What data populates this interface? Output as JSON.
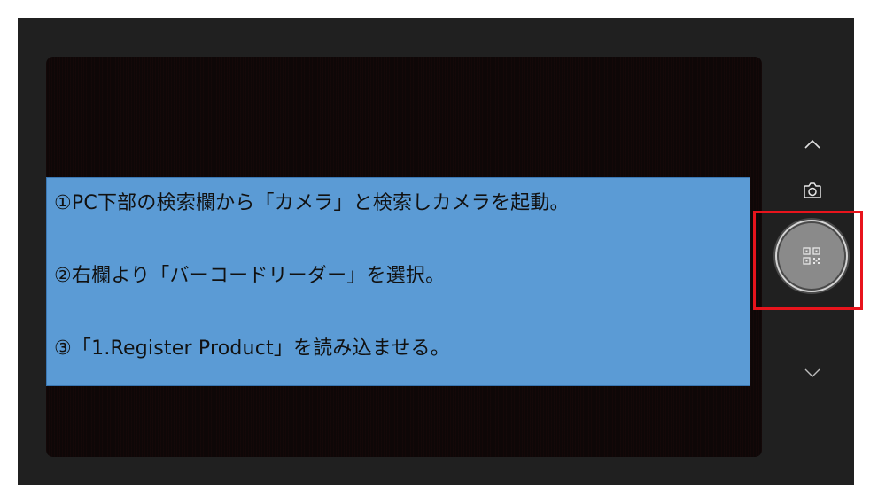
{
  "instructions": {
    "step1": "①PC下部の検索欄から「カメラ」と検索しカメラを起動。",
    "step2": "②右欄より「バーコードリーダー」を選択。",
    "step3": "③「1.Register Product」を読み込ませる。"
  },
  "controls": {
    "scroll_up_icon": "chevron-up-icon",
    "photo_mode_icon": "camera-icon",
    "barcode_shutter_icon": "qr-code-icon",
    "scroll_down_icon": "chevron-down-icon"
  },
  "colors": {
    "window_bg": "#202020",
    "instruction_bg": "#5b9bd5",
    "highlight": "#e8141c",
    "shutter": "#8a8a8a"
  }
}
